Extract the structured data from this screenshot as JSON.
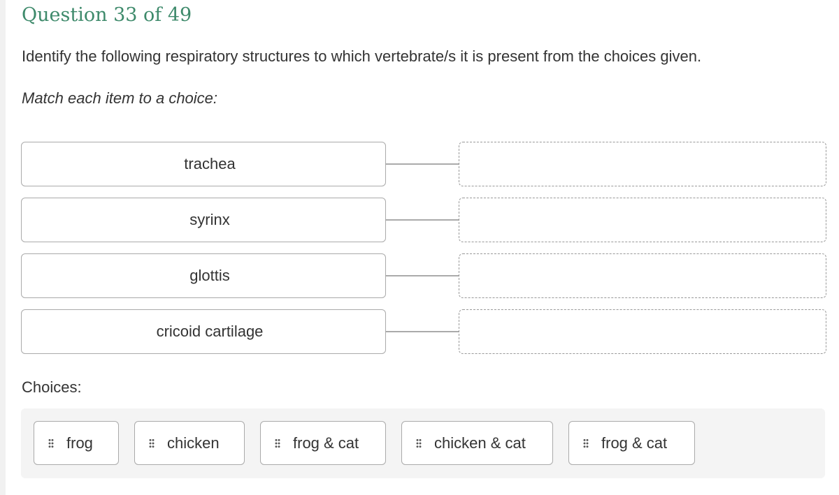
{
  "header": {
    "title": "Question 33 of 49"
  },
  "question": {
    "prompt": "Identify the following respiratory structures to which vertebrate/s it is present from the choices given.",
    "instruction": "Match each item to a choice:"
  },
  "items": [
    {
      "label": "trachea"
    },
    {
      "label": "syrinx"
    },
    {
      "label": "glottis"
    },
    {
      "label": "cricoid cartilage"
    }
  ],
  "choices_label": "Choices:",
  "choices": [
    {
      "label": "frog"
    },
    {
      "label": "chicken"
    },
    {
      "label": "frog & cat"
    },
    {
      "label": "chicken & cat"
    },
    {
      "label": "frog & cat"
    }
  ]
}
